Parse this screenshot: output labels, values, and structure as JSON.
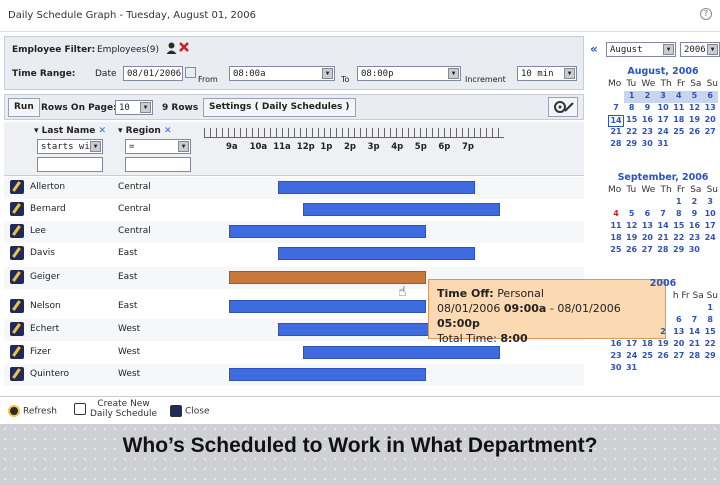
{
  "window": {
    "title": "Daily Schedule Graph - Tuesday, August 01, 2006",
    "help_icon": "?"
  },
  "filters": {
    "employee_label": "Employee Filter:",
    "employee_value": "Employees(9)",
    "time_range_label": "Time Range:",
    "date_label": "Date",
    "date_value": "08/01/2006",
    "from_label": "From",
    "from_value": "08:00a",
    "to_label": "To",
    "to_value": "08:00p",
    "increment_label": "Increment",
    "increment_value": "10 min"
  },
  "toolbar": {
    "run_label": "Run",
    "rows_label": "Rows On Page:",
    "rows_value": "10",
    "rows_count": "9 Rows",
    "settings_label": "Settings ( Daily Schedules )"
  },
  "columns": {
    "last_name": "Last Name",
    "region": "Region",
    "last_name_filter": "starts with",
    "region_filter": "="
  },
  "timeline_ticks": [
    "9a",
    "10a",
    "11a",
    "12p",
    "1p",
    "2p",
    "3p",
    "4p",
    "5p",
    "6p",
    "7p"
  ],
  "rows": [
    {
      "name": "Allerton",
      "region": "Central",
      "start": 11.0,
      "end": 19.0,
      "type": "work"
    },
    {
      "name": "Bernard",
      "region": "Central",
      "start": 12.0,
      "end": 20.0,
      "type": "work"
    },
    {
      "name": "Lee",
      "region": "Central",
      "start": 9.0,
      "end": 17.0,
      "type": "work"
    },
    {
      "name": "Davis",
      "region": "East",
      "start": 11.0,
      "end": 19.0,
      "type": "work"
    },
    {
      "name": "Geiger",
      "region": "East",
      "start": 9.0,
      "end": 17.0,
      "type": "off"
    },
    {
      "name": "Nelson",
      "region": "East",
      "start": 9.0,
      "end": 17.0,
      "type": "work"
    },
    {
      "name": "Echert",
      "region": "West",
      "start": 11.0,
      "end": 19.0,
      "type": "work"
    },
    {
      "name": "Fizer",
      "region": "West",
      "start": 12.0,
      "end": 20.0,
      "type": "work"
    },
    {
      "name": "Quintero",
      "region": "West",
      "start": 9.0,
      "end": 17.0,
      "type": "work"
    }
  ],
  "tooltip": {
    "line1_label": "Time Off:",
    "line1_value": "Personal",
    "line2_date1": "08/01/2006",
    "line2_time1": "09:00a",
    "line2_sep": "-",
    "line2_date2": "08/01/2006",
    "line2_time2": "05:00p",
    "line3_label": "Total Time:",
    "line3_value": "8:00"
  },
  "calendar": {
    "month_select": "August",
    "year_select": "2006",
    "dow": [
      "Mo",
      "Tu",
      "We",
      "Th",
      "Fr",
      "Sa",
      "Su"
    ],
    "aug_title": "August, 2006",
    "aug_weeks": [
      [
        "1",
        "2",
        "3",
        "4",
        "5",
        "6"
      ],
      [
        "7",
        "8",
        "9",
        "10",
        "11",
        "12",
        "13"
      ],
      [
        "14",
        "15",
        "16",
        "17",
        "18",
        "19",
        "20"
      ],
      [
        "21",
        "22",
        "23",
        "24",
        "25",
        "26",
        "27"
      ],
      [
        "28",
        "29",
        "30",
        "31"
      ]
    ],
    "sep_title": "September, 2006",
    "sep_weeks": [
      [
        "1",
        "2",
        "3"
      ],
      [
        "4",
        "5",
        "6",
        "7",
        "8",
        "9",
        "10"
      ],
      [
        "11",
        "12",
        "13",
        "14",
        "15",
        "16",
        "17"
      ],
      [
        "18",
        "19",
        "20",
        "21",
        "22",
        "23",
        "24"
      ],
      [
        "25",
        "26",
        "27",
        "28",
        "29",
        "30"
      ]
    ],
    "oct_title": "2006",
    "oct_dow_partial": "h Fr Sa Su",
    "oct_weeks": [
      [
        "1"
      ],
      [
        "6",
        "7",
        "8"
      ],
      [
        "2",
        "13",
        "14",
        "15"
      ],
      [
        "16",
        "17",
        "18",
        "19",
        "20",
        "21",
        "22"
      ],
      [
        "23",
        "24",
        "25",
        "26",
        "27",
        "28",
        "29"
      ],
      [
        "30",
        "31"
      ]
    ]
  },
  "footer": {
    "refresh": "Refresh",
    "create_new_1": "Create New",
    "create_new_2": "Daily Schedule",
    "close": "Close"
  },
  "banner": "Who’s Scheduled to Work in What Department?",
  "colors": {
    "bar": "#3e6be0",
    "off_bar": "#c8783a",
    "tooltip_bg": "#fbd9b2",
    "link": "#2c53b8"
  }
}
